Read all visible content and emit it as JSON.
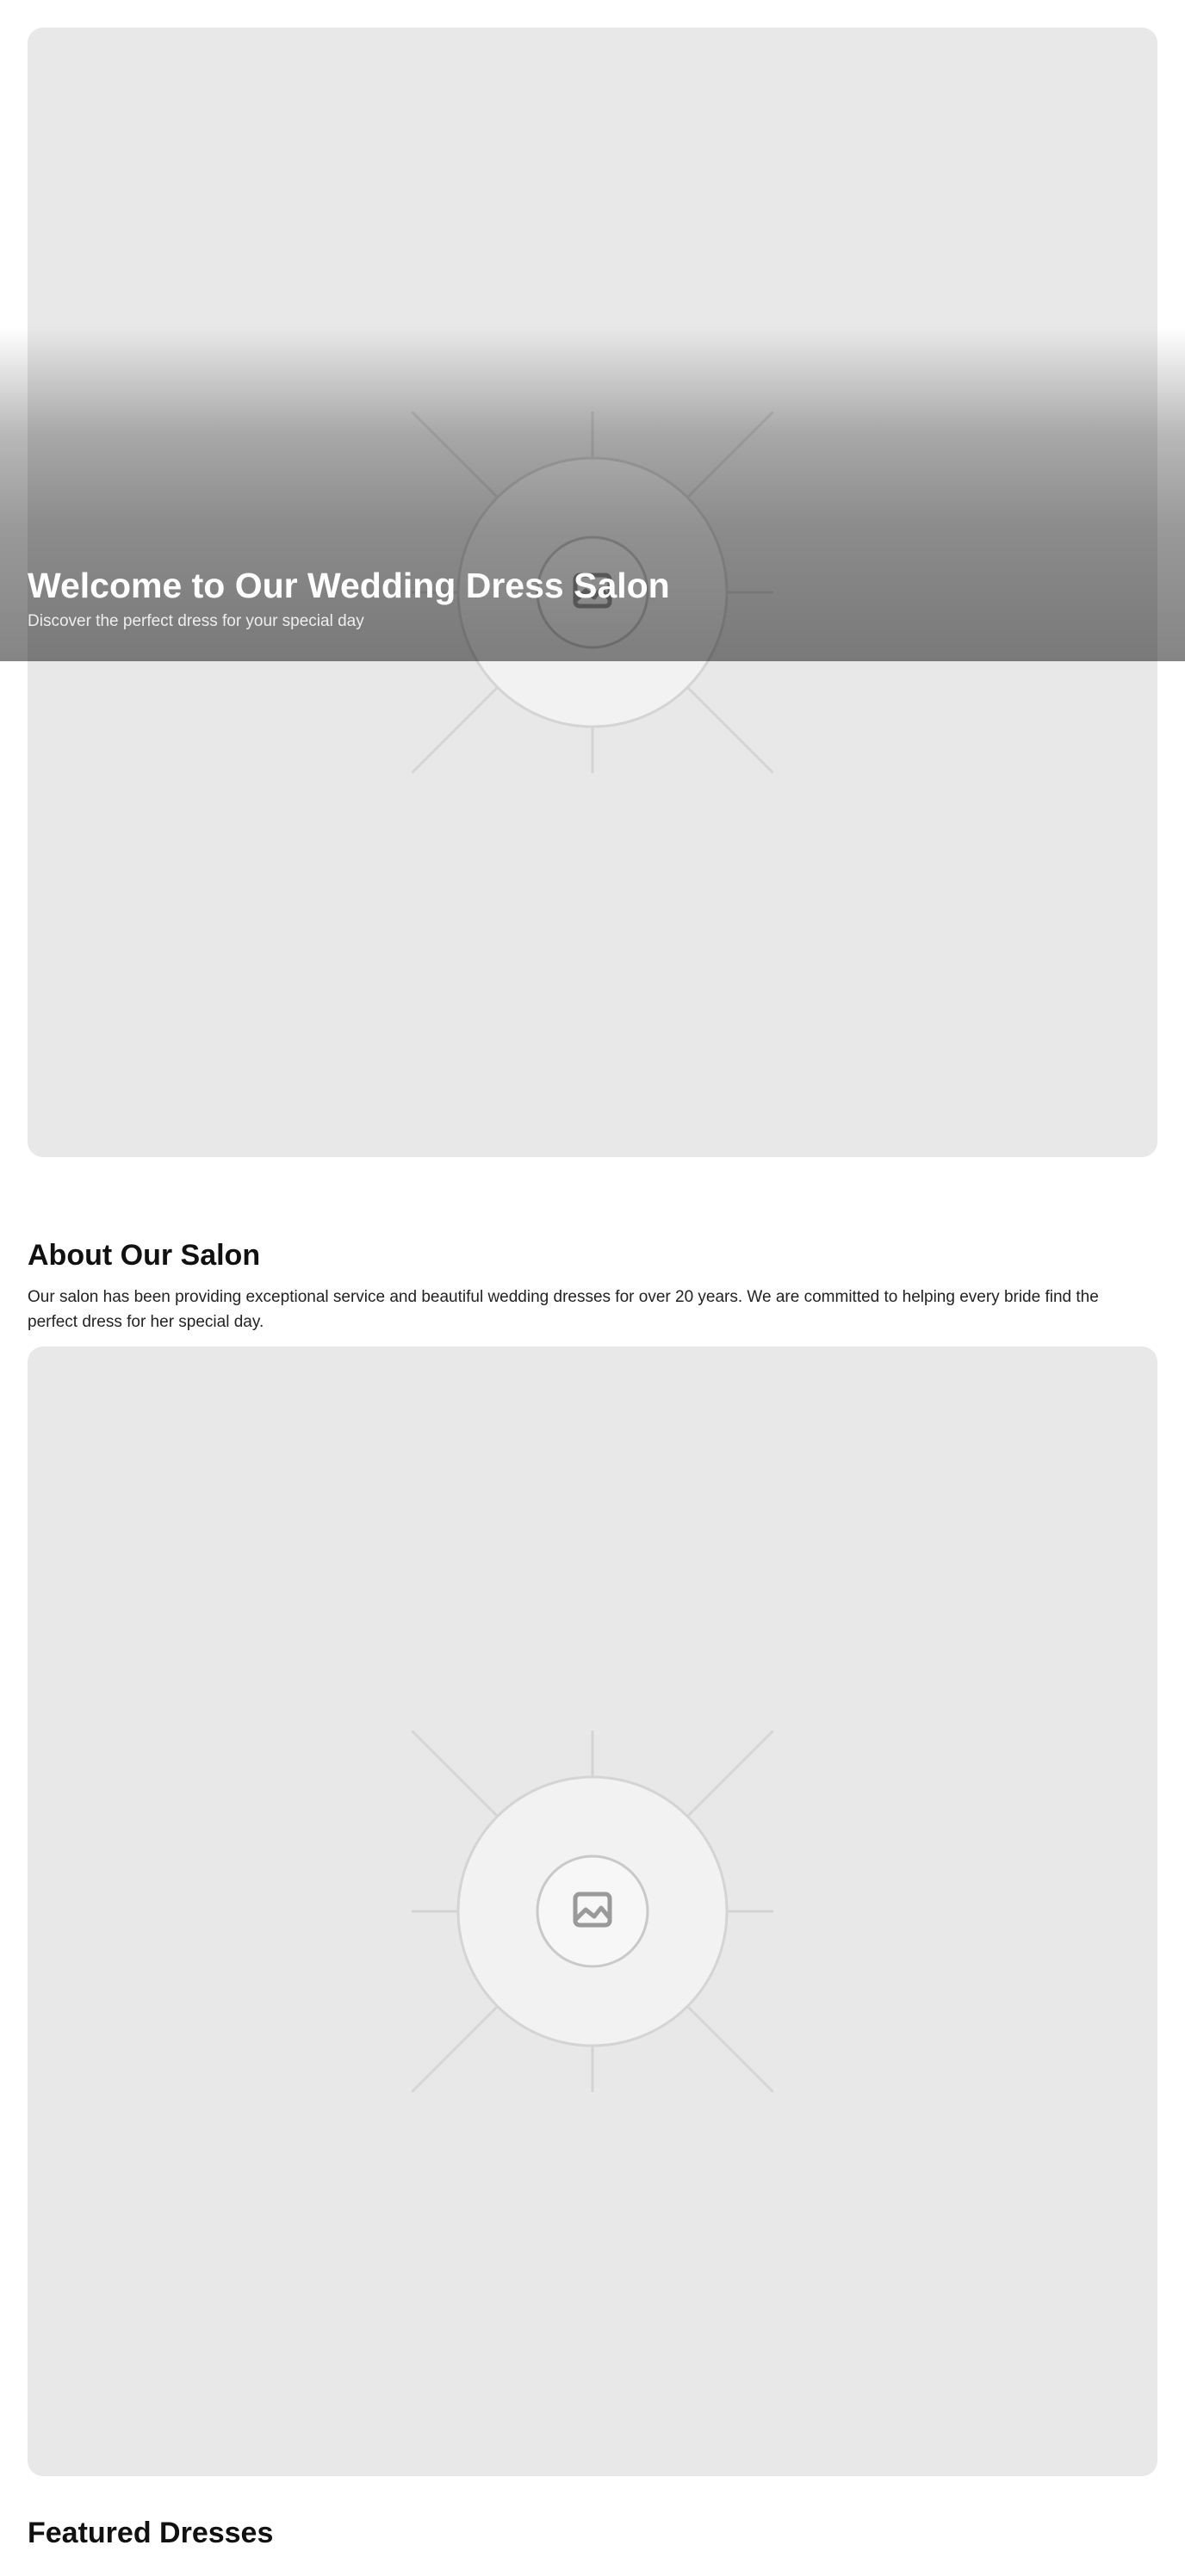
{
  "hero": {
    "title": "Welcome to Our Wedding Dress Salon",
    "subtitle": "Discover the perfect dress for your special day",
    "image_icon": "image-placeholder-icon"
  },
  "about": {
    "title": "About Our Salon",
    "body": "Our salon has been providing exceptional service and beautiful wedding dresses for over 20 years. We are committed to helping every bride find the perfect dress for her special day.",
    "image_icon": "image-placeholder-icon"
  },
  "featured": {
    "title": "Featured Dresses"
  },
  "colors": {
    "page_background": "#ffffff",
    "placeholder_background": "#e8e8e8",
    "heading_text": "#111111",
    "hero_text": "#ffffff"
  }
}
